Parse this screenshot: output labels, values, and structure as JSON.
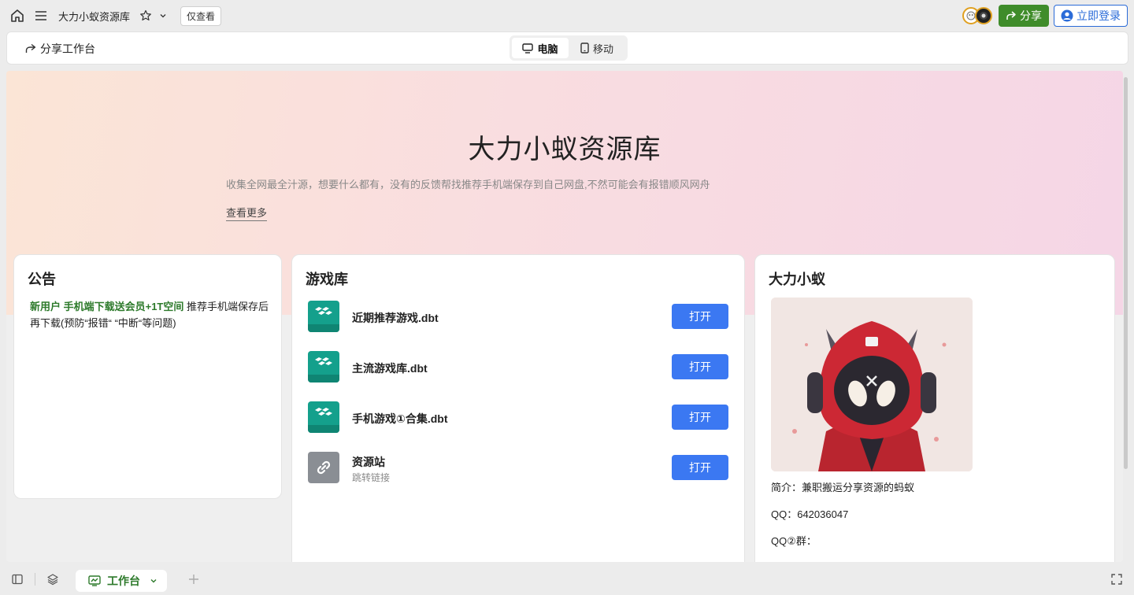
{
  "topbar": {
    "title": "大力小蚁资源库",
    "view_only": "仅查看",
    "share_label": "分享",
    "login_label": "立即登录"
  },
  "subbar": {
    "share_workspace": "分享工作台",
    "views": [
      "电脑",
      "移动"
    ],
    "active_view": "电脑"
  },
  "hero": {
    "title": "大力小蚁资源库",
    "description": "收集全网最全汁源，想要什么都有，没有的反馈帮找推荐手机端保存到自己网盘,不然可能会有报错顺风网舟",
    "more": "查看更多"
  },
  "notice": {
    "title": "公告",
    "highlight": "新用户 手机端下载送会员+1T空间",
    "text": " 推荐手机端保存后再下载(预防“报错“ “中断“等问题)"
  },
  "games": {
    "title": "游戏库",
    "open_label": "打开",
    "items": [
      {
        "name": "近期推荐游戏.dbt",
        "sub": "",
        "icon": "file-app-icon"
      },
      {
        "name": "主流游戏库.dbt",
        "sub": "",
        "icon": "file-app-icon"
      },
      {
        "name": "手机游戏①合集.dbt",
        "sub": "",
        "icon": "file-app-icon"
      },
      {
        "name": "资源站",
        "sub": "跳转链接",
        "icon": "link-icon"
      }
    ]
  },
  "profile": {
    "title": "大力小蚁",
    "intro": "简介：兼职搬运分享资源的蚂蚁",
    "qq": "QQ：642036047",
    "qq_group": "QQ②群："
  },
  "bottombar": {
    "workspace_tab": "工作台"
  },
  "colors": {
    "accent_green": "#3f8c2a",
    "accent_blue": "#3b78f2",
    "login_blue": "#2a6bd8"
  }
}
